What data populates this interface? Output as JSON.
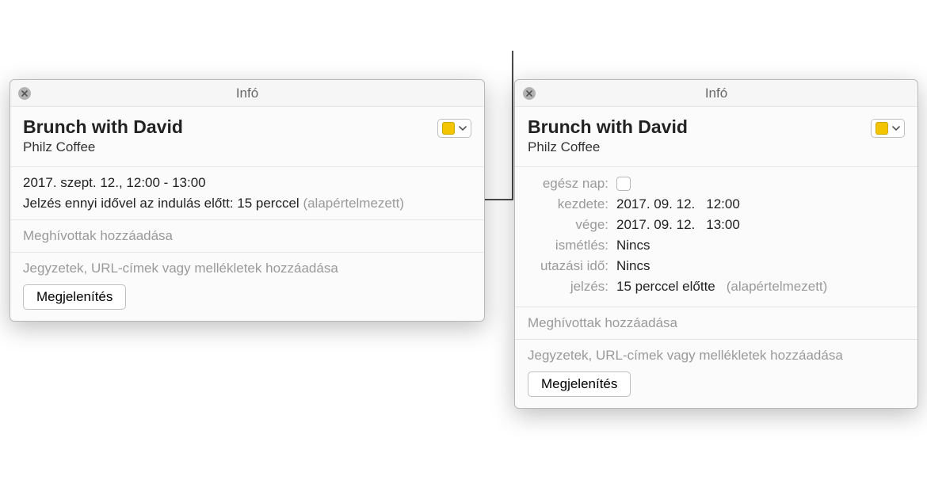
{
  "left": {
    "title": "Infó",
    "event_title": "Brunch with David",
    "event_location": "Philz Coffee",
    "datetime": "2017. szept. 12., 12:00 - 13:00",
    "alert_text": "Jelzés ennyi idővel az indulás előtt: 15 perccel",
    "alert_default": "(alapértelmezett)",
    "invitees_placeholder": "Meghívottak hozzáadása",
    "notes_placeholder": "Jegyzetek, URL-címek vagy mellékletek hozzáadása",
    "show_button": "Megjelenítés",
    "calendar_color": "#f2c500"
  },
  "right": {
    "title": "Infó",
    "event_title": "Brunch with David",
    "event_location": "Philz Coffee",
    "fields": {
      "allday_label": "egész nap:",
      "start_label": "kezdete:",
      "start_date": "2017. 09. 12.",
      "start_time": "12:00",
      "end_label": "vége:",
      "end_date": "2017. 09. 12.",
      "end_time": "13:00",
      "repeat_label": "ismétlés:",
      "repeat_value": "Nincs",
      "travel_label": "utazási idő:",
      "travel_value": "Nincs",
      "alert_label": "jelzés:",
      "alert_value": "15 perccel előtte",
      "alert_default": "(alapértelmezett)"
    },
    "invitees_placeholder": "Meghívottak hozzáadása",
    "notes_placeholder": "Jegyzetek, URL-címek vagy mellékletek hozzáadása",
    "show_button": "Megjelenítés",
    "calendar_color": "#f2c500"
  }
}
